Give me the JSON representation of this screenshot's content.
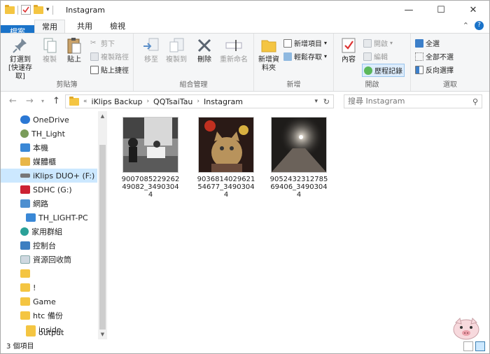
{
  "window": {
    "title": "Instagram",
    "controls": {
      "minimize": "—",
      "maximize": "☐",
      "close": "✕"
    }
  },
  "tabs": {
    "file": "檔案",
    "home": "常用",
    "share": "共用",
    "view": "檢視"
  },
  "ribbon": {
    "clipboard": {
      "label": "剪貼簿",
      "pin": "釘選到 [快速存取]",
      "copy": "複製",
      "paste": "貼上",
      "cut": "剪下",
      "copy_path": "複製路徑",
      "paste_shortcut": "貼上捷徑"
    },
    "organize": {
      "label": "組合管理",
      "move_to": "移至",
      "copy_to": "複製到",
      "delete": "刪除",
      "rename": "重新命名"
    },
    "new": {
      "label": "新增",
      "new_folder": "新增資料夾",
      "new_item": "新增項目",
      "easy_access": "輕鬆存取"
    },
    "open": {
      "label": "開啟",
      "properties": "內容",
      "open": "開啟",
      "edit": "編輯",
      "history": "歷程記錄"
    },
    "select": {
      "label": "選取",
      "select_all": "全選",
      "select_none": "全部不選",
      "invert": "反向選擇"
    }
  },
  "address": {
    "prefix": "«",
    "crumbs": [
      "iKlips Backup",
      "QQTsaiTau",
      "Instagram"
    ],
    "search_placeholder": "搜尋 Instagram"
  },
  "sidebar": {
    "items": [
      {
        "label": "OneDrive"
      },
      {
        "label": "TH_Light"
      },
      {
        "label": "本機"
      },
      {
        "label": "媒體櫃"
      },
      {
        "label": "iKlips DUO+ (F:)"
      },
      {
        "label": "SDHC (G:)"
      },
      {
        "label": "網路"
      },
      {
        "label": "TH_LIGHT-PC"
      },
      {
        "label": "家用群組"
      },
      {
        "label": "控制台"
      },
      {
        "label": "資源回收筒"
      },
      {
        "label": ""
      },
      {
        "label": "!"
      },
      {
        "label": "Game"
      },
      {
        "label": "htc 備份"
      },
      {
        "label": "inside"
      },
      {
        "label": "output"
      }
    ]
  },
  "files": [
    {
      "name": "900708522926249082_34903044"
    },
    {
      "name": "903681402962154677_34903044"
    },
    {
      "name": "905243231278569406_34903044"
    }
  ],
  "status": {
    "count": "3 個項目"
  },
  "colors": {
    "accent": "#1a73c9",
    "selected": "#cce8ff",
    "folder": "#f4c542"
  }
}
